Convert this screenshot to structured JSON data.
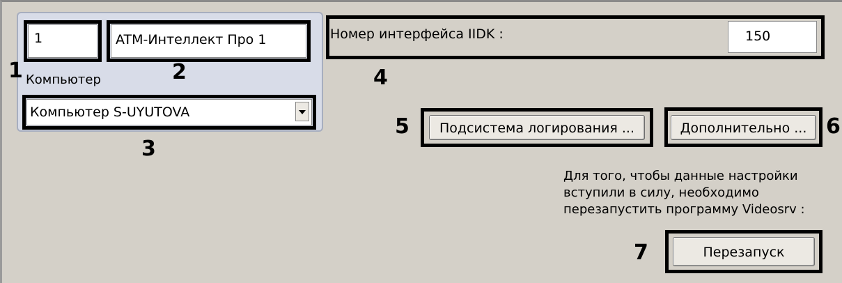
{
  "object": {
    "id_value": "1",
    "name_value": "ATM-Интеллект Про 1",
    "computer_label": "Компьютер",
    "computer_value": "Компьютер S-UYUTOVA"
  },
  "iidk": {
    "label": "Номер интерфейса IIDK :",
    "value": "150"
  },
  "buttons": {
    "logging_label": "Подсистема логирования ...",
    "advanced_label": "Дополнительно ...",
    "restart_label": "Перезапуск"
  },
  "note": {
    "line1": "Для того, чтобы данные настройки",
    "line2": "вступили в силу, необходимо",
    "line3": "перезапустить программу Videosrv :"
  },
  "callouts": {
    "n1": "1",
    "n2": "2",
    "n3": "3",
    "n4": "4",
    "n5": "5",
    "n6": "6",
    "n7": "7"
  },
  "icons": {
    "dropdown": "chevron-down-icon"
  }
}
